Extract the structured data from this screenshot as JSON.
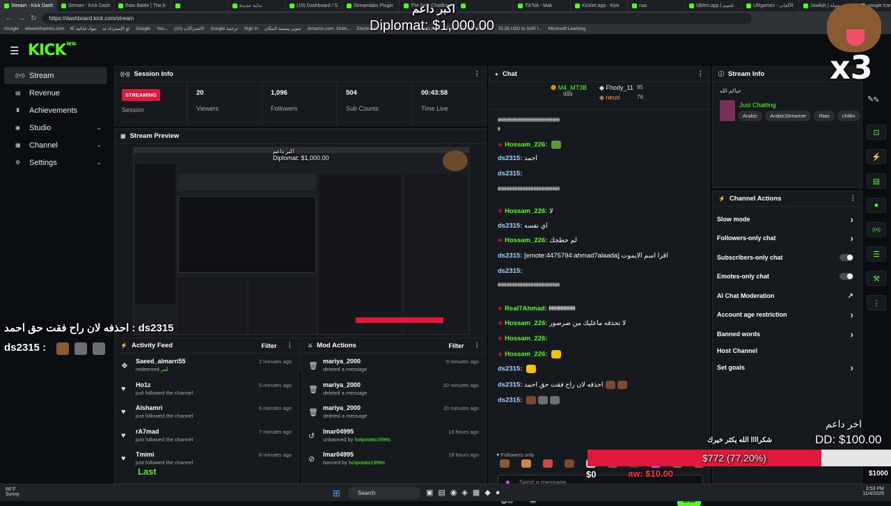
{
  "browser": {
    "tabs": [
      "Stream - Kick Dash",
      "Stream - Kick Dash",
      "INas Battle | The b",
      "",
      "بداية جديدة",
      "(19) Dashboard / S",
      "Streamlabs Plugin",
      "The best ChatBot",
      "",
      "TikTok - Mak",
      "Kicklet.app - Kick",
      "nas",
      "i3bhm.app | لحبيم",
      "URgames - الألعاب",
      "Jawlish | جولة",
      "google translate"
    ],
    "url": "https://dashboard.kick.com/stream",
    "bookmarks": [
      "Google",
      "wheelofnames.com",
      "IE لغ الإسترداد من",
      "مواد غذائية",
      "Google",
      "You...",
      "(10) الاشتراكات",
      "Google ترجمة",
      "Sign In",
      "سوبر بيستية المكان",
      "Amazon.com: Onlin...",
      "Electronics, Cars, Fa...",
      "AliExpress.com",
      "Fishertest US Parcel...",
      "15.28 USD to SAR I...",
      "Microsoft Learning"
    ]
  },
  "nav": {
    "logo": "KICK",
    "logo_sup": "BETA"
  },
  "sidebar": [
    {
      "label": "Stream",
      "icon": "broadcast-icon",
      "chev": ""
    },
    {
      "label": "Revenue",
      "icon": "wallet-icon",
      "chev": ""
    },
    {
      "label": "Achievements",
      "icon": "trophy-icon",
      "chev": ""
    },
    {
      "label": "Studio",
      "icon": "studio-icon",
      "chev": "⌄"
    },
    {
      "label": "Channel",
      "icon": "channel-icon",
      "chev": "⌄"
    },
    {
      "label": "Settings",
      "icon": "gear-icon",
      "chev": "⌄"
    }
  ],
  "session": {
    "title": "Session Info",
    "badge": "STREAMING",
    "badge_label": "Session",
    "stats": [
      {
        "value": "20",
        "label": "Viewers"
      },
      {
        "value": "1,096",
        "label": "Followers"
      },
      {
        "value": "504",
        "label": "Sub Counts"
      },
      {
        "value": "00:43:58",
        "label": "Time Live"
      }
    ]
  },
  "preview": {
    "title": "Stream Preview",
    "overlay_top": "اكبر داعم",
    "overlay_amount": "Diplomat: $1,000.00"
  },
  "activity": {
    "title": "Activity Feed",
    "filter": "Filter",
    "items": [
      {
        "name": "Saeed_almarri55",
        "action": "redeemed",
        "extra": "لمر",
        "time": "2 minutes ago"
      },
      {
        "name": "Ho1z",
        "action": "just followed the channel",
        "extra": "",
        "time": "5 minutes ago"
      },
      {
        "name": "Alshamri",
        "action": "just followed the channel",
        "extra": "",
        "time": "6 minutes ago"
      },
      {
        "name": "rA7mad",
        "action": "just followed the channel",
        "extra": "",
        "time": "7 minutes ago"
      },
      {
        "name": "Tmimi",
        "action": "just followed the channel",
        "extra": "",
        "time": "8 minutes ago"
      }
    ]
  },
  "mod": {
    "title": "Mod Actions",
    "filter": "Filter",
    "items": [
      {
        "name": "mariya_2000",
        "action": "deleted a message",
        "extra": "",
        "time": "9 minutes ago"
      },
      {
        "name": "mariya_2000",
        "action": "deleted a message",
        "extra": "",
        "time": "20 minutes ago"
      },
      {
        "name": "mariya_2000",
        "action": "deleted a message",
        "extra": "",
        "time": "20 minutes ago"
      },
      {
        "name": "lmar04995",
        "action": "unbanned by",
        "extra": "hotpotato1999s",
        "time": "19 hours ago"
      },
      {
        "name": "lmar04995",
        "action": "banned by",
        "extra": "hotpotato1999s",
        "time": "19 hours ago"
      }
    ]
  },
  "chat": {
    "title": "Chat",
    "top": [
      {
        "name": "M4_MT3B",
        "count": "999"
      },
      {
        "name": "Fhody_11",
        "count": "85"
      },
      {
        "name": "neuo",
        "count": "76"
      }
    ],
    "messages": [
      {
        "user": "",
        "text": "ⱡⱡⱡⱡⱡⱡⱡⱡⱡⱡⱡⱡⱡⱡⱡⱡⱡⱡⱡⱡⱡⱡⱡⱡⱡⱡⱡⱡⱡⱡⱡⱡⱡⱡⱡⱡⱡⱡⱡⱡⱡⱡⱡⱡⱡⱡⱡⱡⱡⱡ"
      },
      {
        "user": "",
        "text": "ⱡⱡ"
      },
      {
        "user": "Hossam_226:",
        "text": ""
      },
      {
        "user": "ds2315:",
        "text": "احمد"
      },
      {
        "user": "ds2315:",
        "text": ""
      },
      {
        "user": "",
        "text": "ⱡⱡⱡⱡⱡⱡⱡⱡⱡⱡⱡⱡⱡⱡⱡⱡⱡⱡⱡⱡⱡⱡⱡⱡⱡⱡⱡⱡⱡⱡⱡⱡⱡⱡⱡⱡⱡⱡⱡⱡⱡⱡⱡⱡⱡⱡⱡⱡⱡⱡ"
      },
      {
        "user": "Hossam_226:",
        "text": "لا"
      },
      {
        "user": "ds2315:",
        "text": "اي نفسه"
      },
      {
        "user": "Hossam_226:",
        "text": "لم حطجك"
      },
      {
        "user": "ds2315:",
        "text": "[emote:4475794:ahmad7alaada] اقرا اسم الايموت"
      },
      {
        "user": "ds2315:",
        "text": ""
      },
      {
        "user": "",
        "text": "ⱡⱡⱡⱡⱡⱡⱡⱡⱡⱡⱡⱡⱡⱡⱡⱡⱡⱡⱡⱡⱡⱡⱡⱡⱡⱡⱡⱡⱡⱡⱡⱡⱡⱡⱡⱡⱡⱡⱡⱡⱡⱡⱡⱡⱡⱡⱡⱡⱡⱡ"
      },
      {
        "user": "Real7Ahmad:",
        "text": "ⱡⱡⱡⱡⱡⱡⱡⱡⱡⱡⱡⱡⱡⱡⱡⱡⱡⱡ"
      },
      {
        "user": "Hossam_226:",
        "text": "لا تحذفه ماعليك من صرصور"
      },
      {
        "user": "Hossam_226:",
        "text": ""
      },
      {
        "user": "Hossam_226:",
        "text": ""
      },
      {
        "user": "ds2315:",
        "text": ""
      },
      {
        "user": "ds2315:",
        "text": "احذفه لان راح فقت حق احمد"
      },
      {
        "user": "ds2315:",
        "text": ""
      }
    ],
    "followers_only": "Followers only",
    "placeholder": "Send a message",
    "send": "Chat"
  },
  "streaminfo": {
    "title": "Stream Info",
    "streamer": "حياكم الله",
    "category": "Just Chatting",
    "tags": [
      "Arabic",
      "ArabicStreamer",
      "INas",
      "chillin"
    ]
  },
  "actions": {
    "title": "Channel Actions",
    "items": [
      {
        "label": "Slow mode",
        "kind": "arrow"
      },
      {
        "label": "Followers-only chat",
        "kind": "arrow"
      },
      {
        "label": "Subscribers-only chat",
        "kind": "toggle"
      },
      {
        "label": "Emotes-only chat",
        "kind": "toggle"
      },
      {
        "label": "AI Chat Moderation",
        "kind": "ext"
      },
      {
        "label": "Account age restriction",
        "kind": "arrow"
      },
      {
        "label": "Banned words",
        "kind": "arrow"
      },
      {
        "label": "Host Channel",
        "kind": "none"
      },
      {
        "label": "Set goals",
        "kind": "arrow"
      }
    ]
  },
  "overlays": {
    "top_supporter": "اكبر داعم",
    "top_amount": "Diplomat: $1,000.00",
    "x3": "x3",
    "left_line1": "احذفه لان راح فقت حق احمد : ds2315",
    "left_line2": "ds2315 :",
    "last_label": "Last",
    "last_dono": "اخر داعم",
    "last_amount": "DD: $100.00",
    "thanks": "شكراااا الله يكثر خيرك",
    "goal": "$772 (77.20%)",
    "goal_progress": 0.772,
    "goal_start": "$0",
    "goal_end": "$1000",
    "goal_left": "aw: $10.00"
  },
  "taskbar": {
    "weather": "66°F",
    "weather_sub": "Sunny",
    "search": "Search",
    "time": "3:53 PM",
    "date": "11/4/2025"
  },
  "colors": {
    "accent": "#53fc18",
    "streaming": "#e0193a",
    "goal_bar": "#e0193a"
  }
}
